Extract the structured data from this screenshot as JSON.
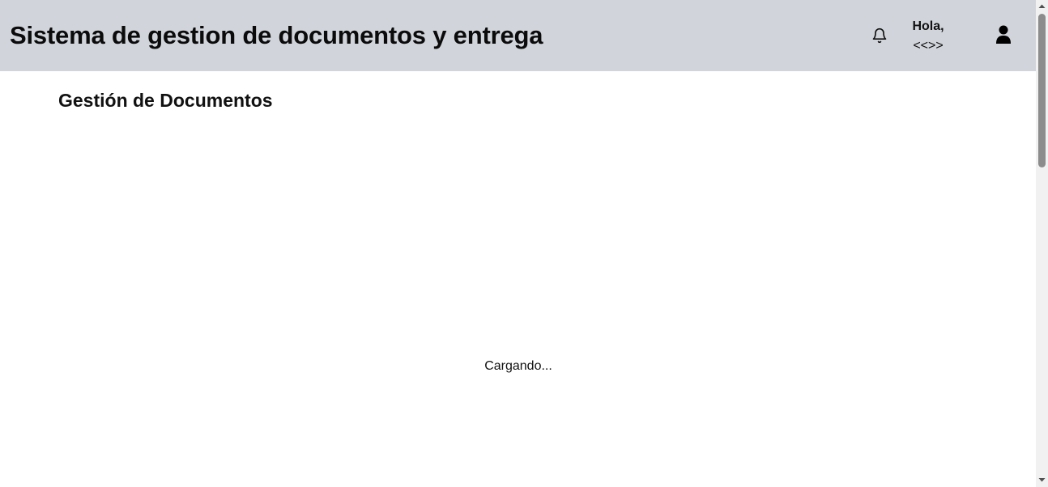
{
  "header": {
    "title": "Sistema de gestion de documentos y entrega",
    "greeting_line1": "Hola,",
    "greeting_line2": "<<>>",
    "notification_icon": "bell-icon",
    "user_icon": "user-icon"
  },
  "main": {
    "section_title": "Gestión de Documentos",
    "loading_text": "Cargando..."
  },
  "colors": {
    "header_background": "#d1d5db",
    "page_background": "#ffffff",
    "text": "#111111"
  }
}
